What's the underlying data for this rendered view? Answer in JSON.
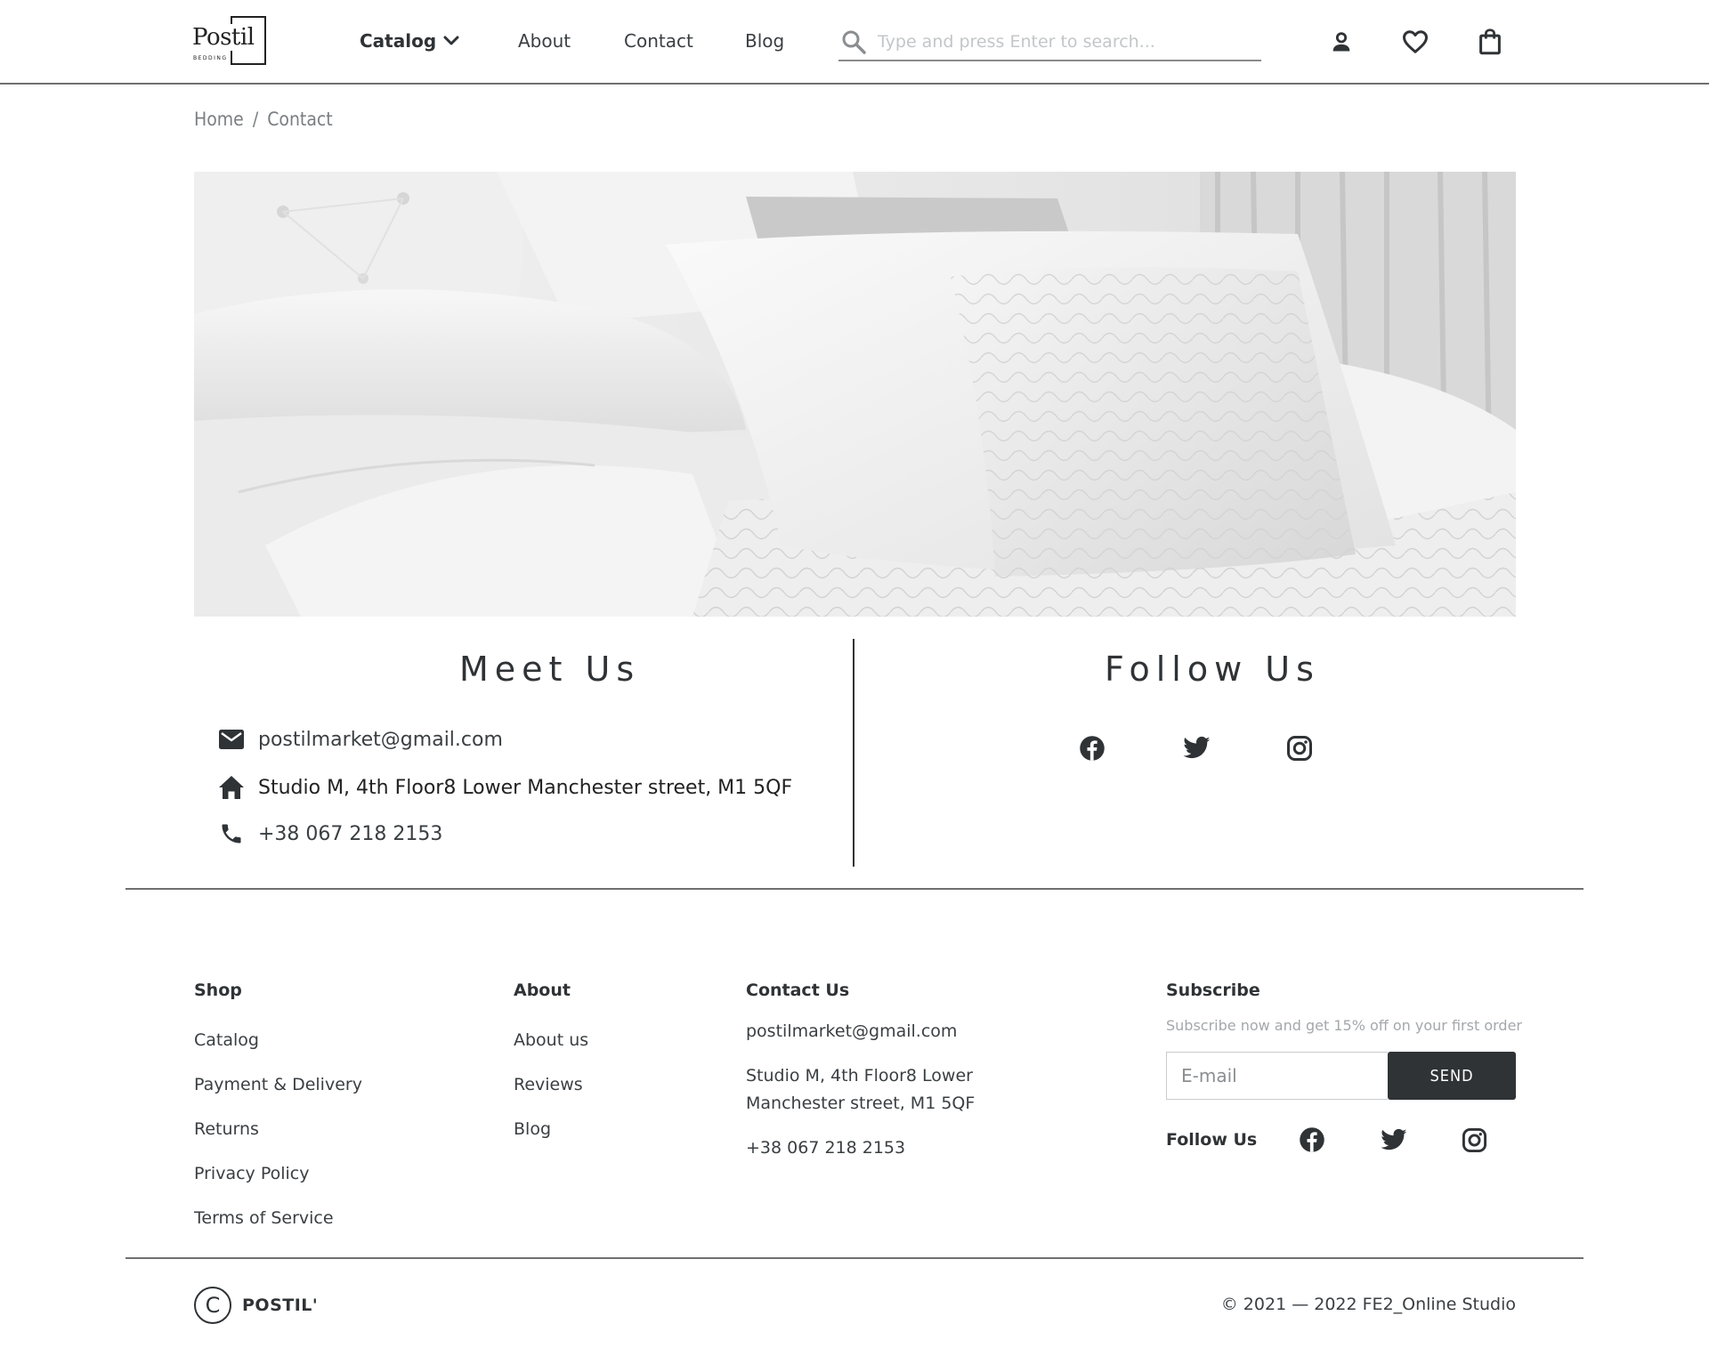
{
  "header": {
    "logo_word": "Postil",
    "logo_sub": "BEDDING",
    "nav": {
      "catalog": "Catalog",
      "about": "About",
      "contact": "Contact",
      "blog": "Blog"
    },
    "search_placeholder": "Type and press Enter to search..."
  },
  "breadcrumb": {
    "home": "Home",
    "separator": "/",
    "current": "Contact"
  },
  "meet": {
    "title": "Meet Us",
    "email": "postilmarket@gmail.com",
    "address": "Studio M, 4th Floor8 Lower Manchester street, M1 5QF",
    "phone": "+38 067 218 2153"
  },
  "follow": {
    "title": "Follow Us",
    "icons": [
      "facebook-icon",
      "twitter-icon",
      "instagram-icon"
    ]
  },
  "footer": {
    "shop": {
      "heading": "Shop",
      "links": [
        "Catalog",
        "Payment & Delivery",
        "Returns",
        "Privacy Policy",
        "Terms of Service"
      ]
    },
    "about": {
      "heading": "About",
      "links": [
        "About us",
        "Reviews",
        "Blog"
      ]
    },
    "contact": {
      "heading": "Contact Us",
      "email": "postilmarket@gmail.com",
      "address_line1": "Studio M, 4th Floor8 Lower",
      "address_line2": "Manchester street, M1 5QF",
      "phone": "+38 067 218 2153"
    },
    "subscribe": {
      "heading": "Subscribe",
      "note": "Subscribe now and get 15% off on your first order",
      "placeholder": "E-mail",
      "button": "SEND",
      "follow_label": "Follow Us"
    },
    "brand": "POSTIL'",
    "copyright_symbol": "C",
    "copyright": "© 2021 — 2022 FE2_Online Studio"
  },
  "colors": {
    "primary": "#2f3336",
    "muted": "#7b7f82",
    "divider": "#6f6f6f",
    "hero_bg": "#e9e9e9"
  }
}
